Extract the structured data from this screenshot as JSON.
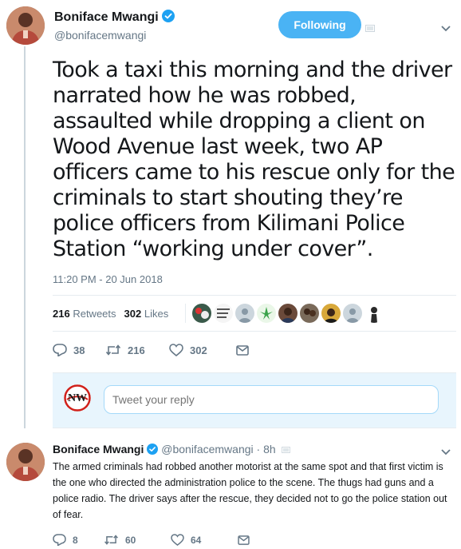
{
  "tweet": {
    "author_name": "Boniface Mwangi",
    "author_handle": "@bonifacemwangi",
    "follow_label": "Following",
    "text": "Took a taxi this morning and the driver narrated how he was robbed, assaulted while dropping a client on Wood Avenue last week, two AP officers came to his rescue only for the criminals to start shouting they’re police officers from Kilimani Police Station “working under cover”.",
    "timestamp": "11:20 PM - 20 Jun 2018",
    "retweets_count": "216",
    "retweets_label": "Retweets",
    "likes_count": "302",
    "likes_label": "Likes",
    "actions": {
      "replies": "38",
      "retweets": "216",
      "likes": "302"
    }
  },
  "reply_box": {
    "placeholder": "Tweet your reply"
  },
  "reply_tweet": {
    "author_name": "Boniface Mwangi",
    "author_handle": "@bonifacemwangi",
    "separator": "·",
    "time": "8h",
    "text": "The armed criminals had robbed another motorist at the same spot and that first victim is the one who directed the administration police to the scene. The thugs had guns and a police radio. The driver says after the rescue, they decided not to go the police station out of fear.",
    "actions": {
      "replies": "8",
      "retweets": "60",
      "likes": "64"
    }
  },
  "colors": {
    "accent": "#1da1f2",
    "follow_button": "#4ab3f4",
    "secondary_text": "#657786",
    "reply_box_bg": "#e8f5fd"
  },
  "icons": [
    "verified-badge-icon",
    "reply-icon",
    "retweet-icon",
    "like-icon",
    "message-icon",
    "chevron-down-icon",
    "caret-icon"
  ]
}
